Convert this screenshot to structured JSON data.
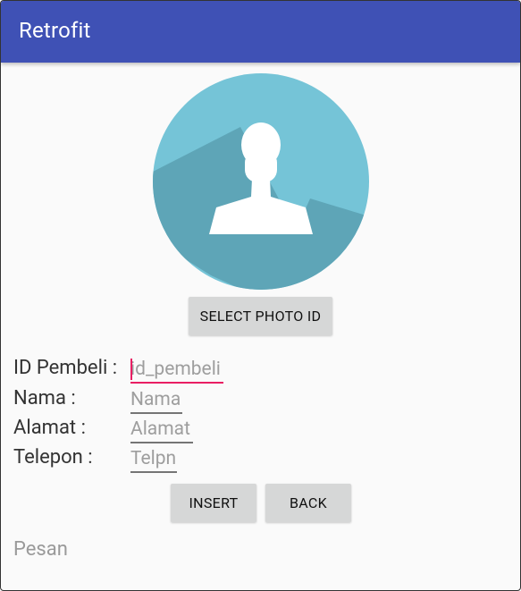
{
  "appbar": {
    "title": "Retrofit",
    "color": "#3f51b5"
  },
  "avatar": {
    "icon": "person-silhouette-icon",
    "bg_color": "#75c4d7"
  },
  "buttons": {
    "select_photo": "SELECT PHOTO ID",
    "insert": "INSERT",
    "back": "BACK"
  },
  "form": {
    "id_pembeli": {
      "label": "ID Pembeli :",
      "placeholder": "id_pembeli",
      "value": ""
    },
    "nama": {
      "label": "Nama :",
      "placeholder": "Nama",
      "value": ""
    },
    "alamat": {
      "label": "Alamat :",
      "placeholder": "Alamat",
      "value": ""
    },
    "telepon": {
      "label": "Telepon :",
      "placeholder": "Telpn",
      "value": ""
    }
  },
  "pesan": "Pesan",
  "accent_color": "#e91e63"
}
